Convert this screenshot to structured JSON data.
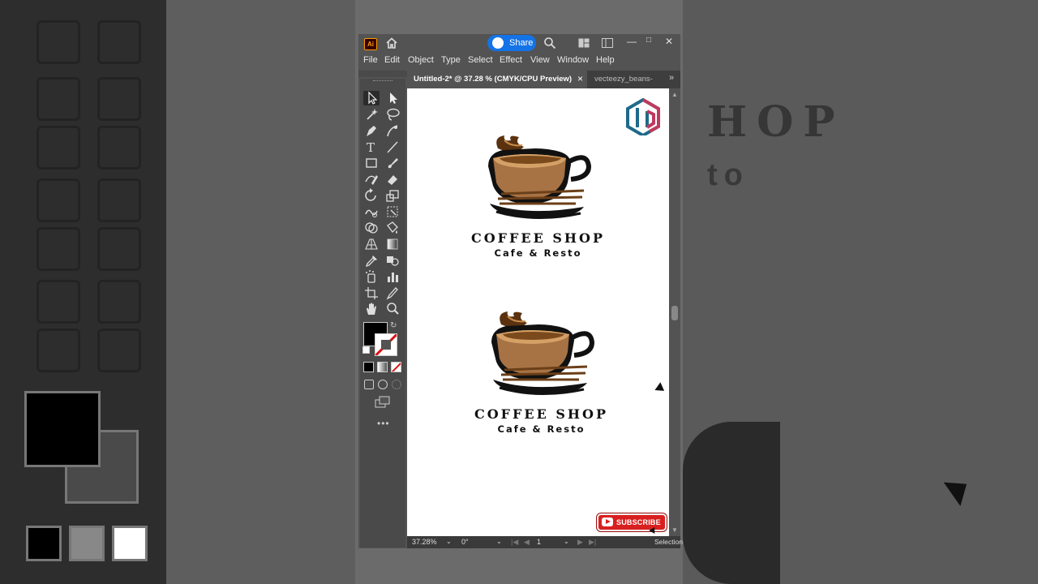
{
  "menubar": {
    "items": [
      "File",
      "Edit",
      "Object",
      "Type",
      "Select",
      "Effect",
      "View",
      "Window",
      "Help"
    ]
  },
  "titlebar": {
    "app_badge": "Ai",
    "share_label": "Share"
  },
  "tabs": {
    "active": "Untitled-2* @ 37.28 % (CMYK/CPU Preview)",
    "inactive": "vecteezy_beans-"
  },
  "logo_top": {
    "title": "COFFEE SHOP",
    "subtitle": "Cafe & Resto"
  },
  "logo_bottom": {
    "title": "COFFEE SHOP",
    "subtitle": "Cafe & Resto"
  },
  "subscribe": {
    "label": "SUBSCRIBE"
  },
  "statusbar": {
    "zoom": "37.28%",
    "rotation": "0°",
    "artboard": "1",
    "tool": "Selection"
  },
  "background": {
    "ghost_title": "HOP",
    "ghost_sub": "to"
  },
  "colors": {
    "accent": "#1473e6",
    "subscribe_red": "#d92020",
    "cup_brown": "#8b5a2b",
    "coffee": "#c9893f"
  }
}
